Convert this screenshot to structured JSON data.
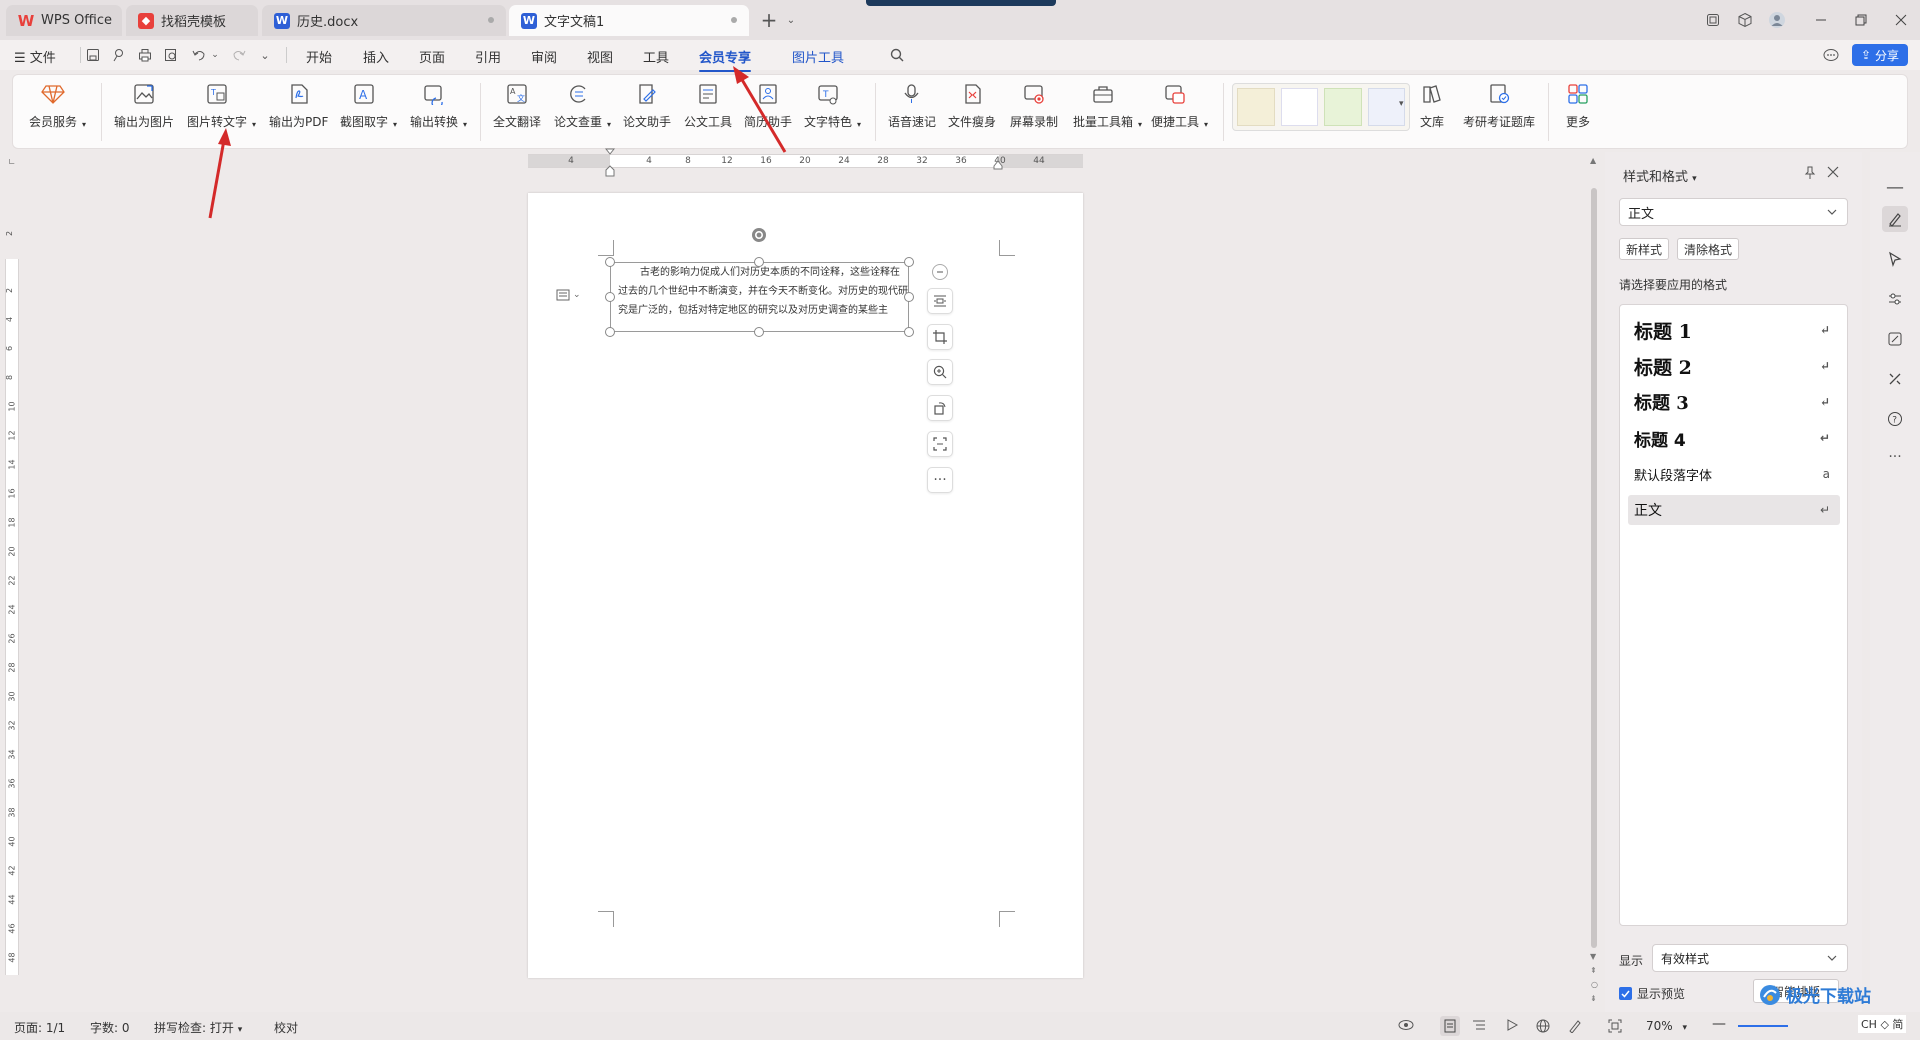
{
  "tabs": [
    {
      "label": "WPS Office",
      "icon": "wps-logo-icon"
    },
    {
      "label": "找稻壳模板",
      "icon": "docer-icon"
    },
    {
      "label": "历史.docx",
      "icon": "word-doc-icon"
    },
    {
      "label": "文字文稿1",
      "icon": "word-doc-icon"
    }
  ],
  "tab_new": "+",
  "menu": {
    "file": "文件",
    "items": [
      "开始",
      "插入",
      "页面",
      "引用",
      "审阅",
      "视图",
      "工具",
      "会员专享"
    ],
    "picture_tools": "图片工具",
    "share": "分享"
  },
  "ribbon": {
    "items": [
      "会员服务",
      "输出为图片",
      "图片转文字",
      "输出为PDF",
      "截图取字",
      "输出转换",
      "全文翻译",
      "论文查重",
      "论文助手",
      "公文工具",
      "简历助手",
      "文字特色",
      "语音速记",
      "文件瘦身",
      "屏幕录制",
      "批量工具箱",
      "便捷工具",
      "文库",
      "考研考证题库",
      "更多"
    ]
  },
  "ruler": {
    "horizontal": [
      "4",
      "",
      "4",
      "8",
      "12",
      "16",
      "20",
      "24",
      "28",
      "32",
      "36",
      "40",
      "44"
    ],
    "vertical": [
      "2",
      "",
      "2",
      "4",
      "6",
      "8",
      "10",
      "12",
      "14",
      "16",
      "18",
      "20",
      "22",
      "24",
      "26",
      "28",
      "30",
      "32",
      "34",
      "36",
      "38",
      "40",
      "42",
      "44",
      "46",
      "48"
    ]
  },
  "document": {
    "textbox": "古老的影响力促成人们对历史本质的不同诠释，这些诠释在过去的几个世纪中不断演变，并在今天不断变化。对历史的现代研究是广泛的，包括对特定地区的研究以及对历史调查的某些主"
  },
  "styles_pane": {
    "title": "样式和格式",
    "current": "正文",
    "new_style": "新样式",
    "clear_format": "清除格式",
    "prompt": "请选择要应用的格式",
    "styles": [
      "标题 1",
      "标题 2",
      "标题 3",
      "标题 4",
      "默认段落字体",
      "正文"
    ],
    "show_label": "显示",
    "show_value": "有效样式",
    "show_preview": "显示预览",
    "smart_layout": "智能排版"
  },
  "status": {
    "page": "页面: 1/1",
    "words": "字数: 0",
    "spell": "拼写检查: 打开",
    "proof": "校对",
    "zoom": "70%"
  },
  "watermark": "极光下载站",
  "ime": "CH ◇ 简",
  "colors": {
    "accent": "#2256c9",
    "wps_red": "#e8403b",
    "word_blue": "#2e5fd6",
    "arrow": "#d42a2a"
  }
}
